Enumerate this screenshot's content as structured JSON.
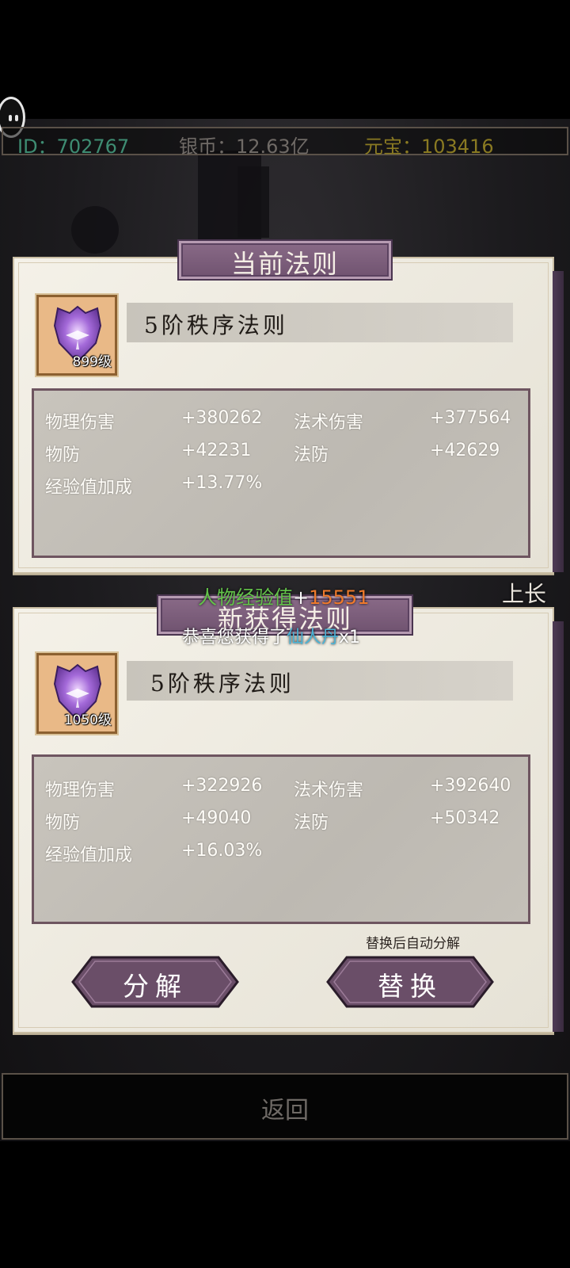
{
  "topbar": {
    "id_text": "ID：702767",
    "silver_text": "银币：12.63亿",
    "yuanbao_text": "元宝：103416",
    "colors": {
      "id": "#3e8c72",
      "silver": "#6f6a66",
      "yuanbao": "#8a7a22"
    }
  },
  "current": {
    "banner": "当前法则",
    "item_name": "5阶秩序法则",
    "item_level": "899级",
    "stats": [
      {
        "label": "物理伤害",
        "value": "+380262"
      },
      {
        "label": "法术伤害",
        "value": "+377564"
      },
      {
        "label": "物防",
        "value": "+42231"
      },
      {
        "label": "法防",
        "value": "+42629"
      },
      {
        "label": "经验值加成",
        "value": "+13.77%"
      }
    ]
  },
  "new": {
    "banner": "新获得法则",
    "item_name": "5阶秩序法则",
    "item_level": "1050级",
    "stats": [
      {
        "label": "物理伤害",
        "value": "+322926"
      },
      {
        "label": "法术伤害",
        "value": "+392640"
      },
      {
        "label": "物防",
        "value": "+49040"
      },
      {
        "label": "法防",
        "value": "+50342"
      },
      {
        "label": "经验值加成",
        "value": "+16.03%"
      }
    ],
    "note": "替换后自动分解",
    "decompose_label": "分解",
    "replace_label": "替换"
  },
  "float": {
    "exp_label": "人物经验值",
    "exp_plus": "+",
    "exp_value": "15551",
    "congrats": "恭喜您获得了",
    "item": "仙人丹",
    "count": "x1",
    "colors": {
      "exp_label": "#63c34a",
      "exp_value": "#ef7a2c",
      "item": "#49b3d6"
    }
  },
  "side_decoration": "上长",
  "back_label": "返回"
}
